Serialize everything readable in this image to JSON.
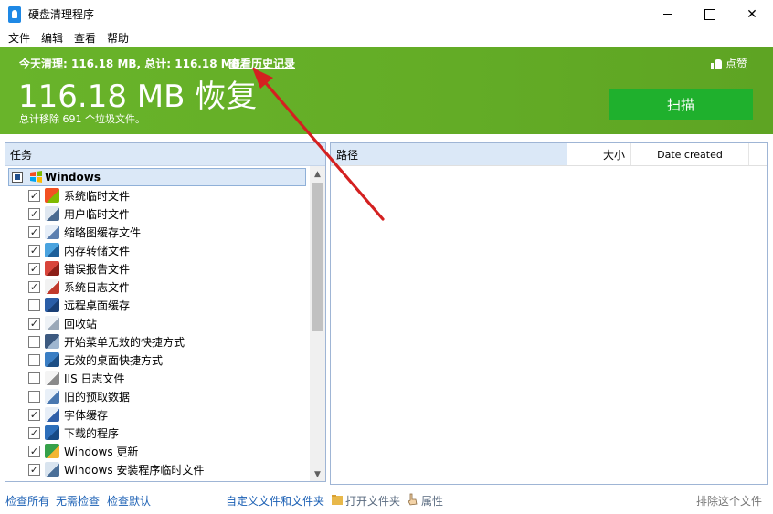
{
  "window": {
    "title": "硬盘清理程序",
    "minimize": "",
    "maximize": "",
    "close": "✕"
  },
  "menu": [
    "文件",
    "编辑",
    "查看",
    "帮助"
  ],
  "header": {
    "summary": "今天清理: 116.18 MB, 总计: 116.18 MB。",
    "history_link": "查看历史记录",
    "big_text": "116.18 MB 恢复",
    "sub_text": "总计移除 691 个垃圾文件。",
    "like_label": "点赞",
    "scan_button": "扫描",
    "colors": {
      "green": "#66b028",
      "scan": "#1fb02d"
    }
  },
  "tasks": {
    "header": "任务",
    "group": "Windows",
    "items": [
      {
        "label": "系统临时文件",
        "checked": true,
        "icon": "windows-flag-icon"
      },
      {
        "label": "用户临时文件",
        "checked": true,
        "icon": "user-file-icon"
      },
      {
        "label": "缩略图缓存文件",
        "checked": true,
        "icon": "thumbnail-icon"
      },
      {
        "label": "内存转储文件",
        "checked": true,
        "icon": "memory-dump-icon"
      },
      {
        "label": "错误报告文件",
        "checked": true,
        "icon": "error-report-icon"
      },
      {
        "label": "系统日志文件",
        "checked": true,
        "icon": "log-search-icon"
      },
      {
        "label": "远程桌面缓存",
        "checked": false,
        "icon": "remote-desktop-icon"
      },
      {
        "label": "回收站",
        "checked": true,
        "icon": "recycle-bin-icon"
      },
      {
        "label": "开始菜单无效的快捷方式",
        "checked": false,
        "icon": "start-menu-icon"
      },
      {
        "label": "无效的桌面快捷方式",
        "checked": false,
        "icon": "desktop-shortcut-icon"
      },
      {
        "label": "IIS 日志文件",
        "checked": false,
        "icon": "iis-log-icon"
      },
      {
        "label": "旧的预取数据",
        "checked": false,
        "icon": "prefetch-clock-icon"
      },
      {
        "label": "字体缓存",
        "checked": true,
        "icon": "font-icon"
      },
      {
        "label": "下载的程序",
        "checked": true,
        "icon": "download-program-icon"
      },
      {
        "label": "Windows 更新",
        "checked": true,
        "icon": "windows-update-icon"
      },
      {
        "label": "Windows 安装程序临时文件",
        "checked": true,
        "icon": "installer-icon"
      }
    ]
  },
  "results": {
    "col_path": "路径",
    "col_size": "大小",
    "col_date": "Date created"
  },
  "bottom": {
    "check_all": "检查所有",
    "no_check": "无需检查",
    "check_default": "检查默认",
    "custom": "自定义文件和文件夹",
    "open_folder": "打开文件夹",
    "properties": "属性",
    "exclude": "排除这个文件"
  }
}
